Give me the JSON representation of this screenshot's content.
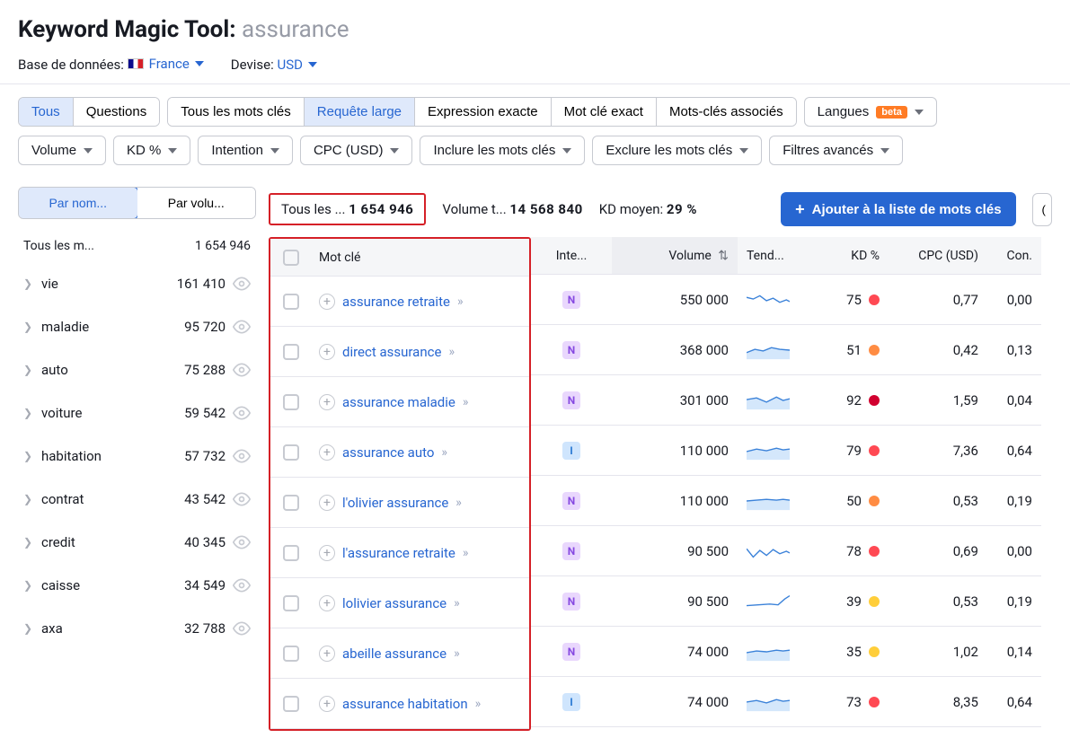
{
  "header": {
    "tool_name": "Keyword Magic Tool:",
    "query": "assurance",
    "db_label": "Base de données:",
    "db_value": "France",
    "currency_label": "Devise:",
    "currency_value": "USD"
  },
  "tabs": {
    "tous": "Tous",
    "questions": "Questions"
  },
  "match": {
    "all": "Tous les mots clés",
    "broad": "Requête large",
    "phrase": "Expression exacte",
    "exact": "Mot clé exact",
    "related": "Mots-clés associés"
  },
  "langBtn": {
    "label": "Langues",
    "badge": "beta"
  },
  "filters": {
    "volume": "Volume",
    "kd": "KD %",
    "intent": "Intention",
    "cpc": "CPC (USD)",
    "include": "Inclure les mots clés",
    "exclude": "Exclure les mots clés",
    "advanced": "Filtres avancés"
  },
  "sidebar": {
    "sort_name": "Par nom...",
    "sort_vol": "Par volu...",
    "header_label": "Tous les m...",
    "header_count": "1 654 946",
    "items": [
      {
        "name": "vie",
        "count": "161 410"
      },
      {
        "name": "maladie",
        "count": "95 720"
      },
      {
        "name": "auto",
        "count": "75 288"
      },
      {
        "name": "voiture",
        "count": "59 542"
      },
      {
        "name": "habitation",
        "count": "57 732"
      },
      {
        "name": "contrat",
        "count": "43 542"
      },
      {
        "name": "credit",
        "count": "40 345"
      },
      {
        "name": "caisse",
        "count": "34 549"
      },
      {
        "name": "axa",
        "count": "32 788"
      }
    ]
  },
  "stats": {
    "all_label": "Tous les ...",
    "all_value": "1 654 946",
    "vol_label": "Volume t...",
    "vol_value": "14 568 840",
    "kd_label": "KD moyen:",
    "kd_value": "29 %",
    "add_btn": "Ajouter à la liste de mots clés"
  },
  "columns": {
    "keyword": "Mot clé",
    "intent": "Inte...",
    "volume": "Volume",
    "trend": "Tend...",
    "kd": "KD %",
    "cpc": "CPC (USD)",
    "com": "Con."
  },
  "rows": [
    {
      "kw": "assurance retraite",
      "intent": "N",
      "volume": "550 000",
      "kd": "75",
      "kd_color": "red",
      "cpc": "0,77",
      "com": "0,00"
    },
    {
      "kw": "direct assurance",
      "intent": "N",
      "volume": "368 000",
      "kd": "51",
      "kd_color": "orange",
      "cpc": "0,42",
      "com": "0,13"
    },
    {
      "kw": "assurance maladie",
      "intent": "N",
      "volume": "301 000",
      "kd": "92",
      "kd_color": "darkred",
      "cpc": "1,59",
      "com": "0,04"
    },
    {
      "kw": "assurance auto",
      "intent": "I",
      "volume": "110 000",
      "kd": "79",
      "kd_color": "red",
      "cpc": "7,36",
      "com": "0,64"
    },
    {
      "kw": "l'olivier assurance",
      "intent": "N",
      "volume": "110 000",
      "kd": "50",
      "kd_color": "orange",
      "cpc": "0,53",
      "com": "0,19"
    },
    {
      "kw": "l'assurance retraite",
      "intent": "N",
      "volume": "90 500",
      "kd": "78",
      "kd_color": "red",
      "cpc": "0,69",
      "com": "0,00"
    },
    {
      "kw": "lolivier assurance",
      "intent": "N",
      "volume": "90 500",
      "kd": "39",
      "kd_color": "yellow",
      "cpc": "0,53",
      "com": "0,19"
    },
    {
      "kw": "abeille assurance",
      "intent": "N",
      "volume": "74 000",
      "kd": "35",
      "kd_color": "yellow",
      "cpc": "1,02",
      "com": "0,14"
    },
    {
      "kw": "assurance habitation",
      "intent": "I",
      "volume": "74 000",
      "kd": "73",
      "kd_color": "red",
      "cpc": "8,35",
      "com": "0,64"
    }
  ]
}
